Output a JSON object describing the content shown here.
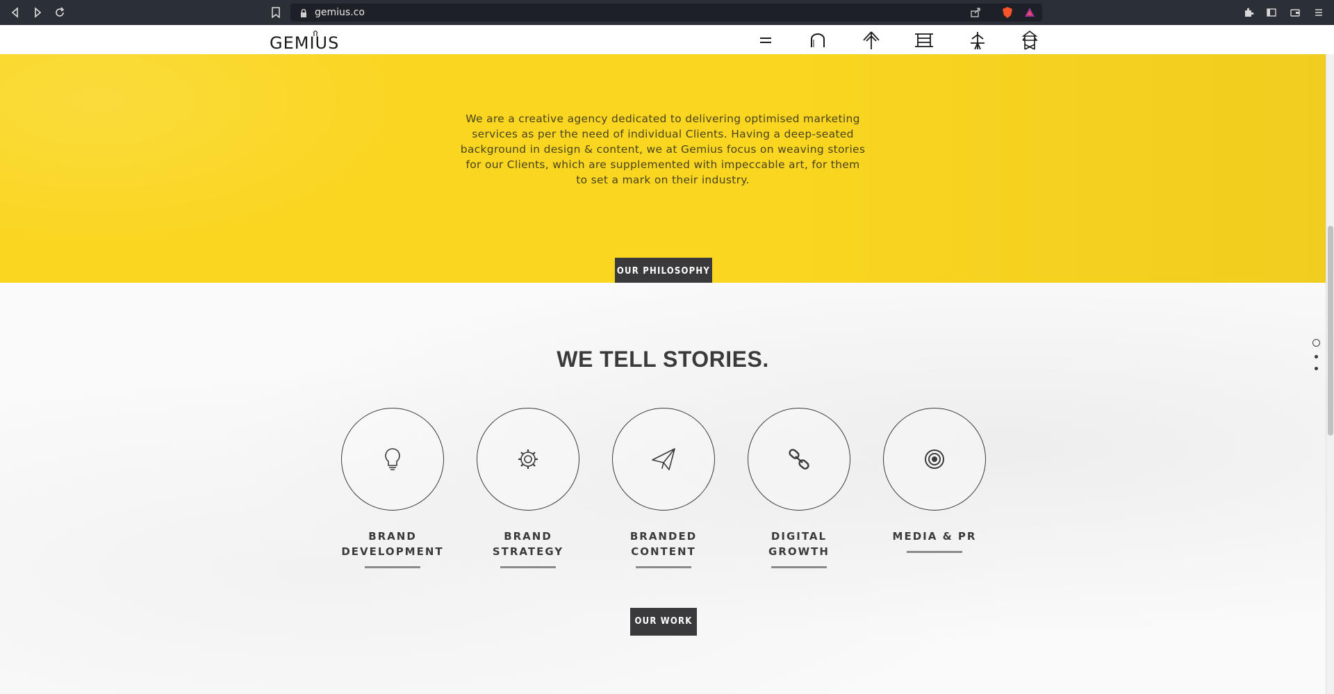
{
  "browser": {
    "url": "gemius.co",
    "back_icon": "back-arrow-icon",
    "forward_icon": "forward-arrow-icon",
    "reload_icon": "reload-icon"
  },
  "header": {
    "logo_text": "GEMIUS",
    "nav_icons": [
      "menu-icon",
      "arch-icon",
      "tree-icon",
      "bench-icon",
      "tower-icon",
      "pagoda-icon"
    ]
  },
  "hero": {
    "text": "We are a creative agency dedicated to delivering optimised marketing services as per the need of individual Clients. Having a deep-seated background in design & content, we at Gemius focus on weaving stories for our Clients, which are supplemented with impeccable art, for them to set a mark on their industry.",
    "button_label": "OUR PHILOSOPHY",
    "bg_color": "#fad620"
  },
  "stories": {
    "title": "WE TELL STORIES.",
    "services": [
      {
        "label": "BRAND DEVELOPMENT",
        "icon": "lightbulb-icon"
      },
      {
        "label": "BRAND STRATEGY",
        "icon": "gear-icon"
      },
      {
        "label": "BRANDED CONTENT",
        "icon": "paper-plane-icon"
      },
      {
        "label": "DIGITAL GROWTH",
        "icon": "link-icon"
      },
      {
        "label": "MEDIA & PR",
        "icon": "target-icon"
      }
    ],
    "button_label": "OUR WORK"
  }
}
